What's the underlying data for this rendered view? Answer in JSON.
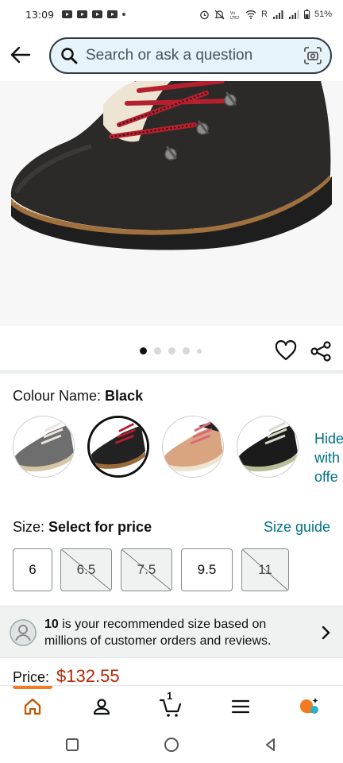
{
  "status_bar": {
    "time": "13:09",
    "network": "R",
    "battery": "51%"
  },
  "search": {
    "placeholder": "Search or ask a question"
  },
  "gallery": {
    "dot_count": 5,
    "active_index": 0
  },
  "colour": {
    "label": "Colour Name: ",
    "selected_value": "Black",
    "swatches": [
      {
        "name": "grey",
        "selected": false
      },
      {
        "name": "black",
        "selected": true
      },
      {
        "name": "tan",
        "selected": false
      },
      {
        "name": "black-olive",
        "selected": false
      }
    ],
    "overflow_link_lines": [
      "Hide",
      "with",
      "offe"
    ]
  },
  "size": {
    "label": "Size: ",
    "prompt": "Select for price",
    "guide_link": "Size guide",
    "options": [
      {
        "label": "6",
        "available": true
      },
      {
        "label": "6.5",
        "available": false
      },
      {
        "label": "7.5",
        "available": false
      },
      {
        "label": "9.5",
        "available": true
      },
      {
        "label": "11",
        "available": false
      }
    ]
  },
  "recommendation": {
    "size": "10",
    "text": " is your recommended size based on millions of customer orders and reviews."
  },
  "price": {
    "label": "Price:",
    "value": "$132.55"
  },
  "bottom_nav": {
    "items": [
      "home-icon",
      "account-icon",
      "cart-icon",
      "menu-icon",
      "rufus-icon"
    ],
    "cart_count": "1",
    "active": "home-icon"
  },
  "colors": {
    "link": "#007185",
    "price": "#b12704",
    "accent": "#f47920",
    "search_bg": "#e6f3fa"
  }
}
